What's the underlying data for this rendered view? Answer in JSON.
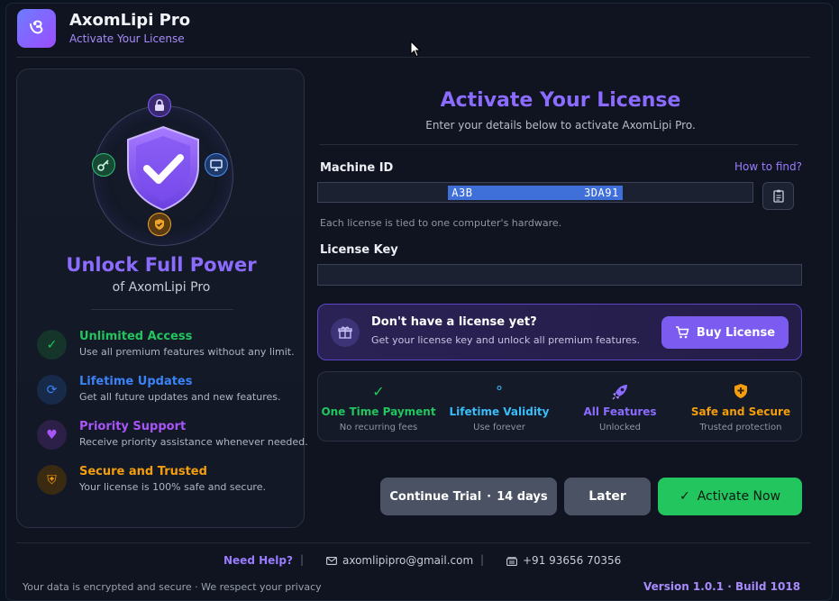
{
  "header": {
    "logo_glyph": "ও",
    "title": "AxomLipi Pro",
    "subtitle": "Activate Your License"
  },
  "left": {
    "heading": "Unlock Full Power",
    "subheading": "of AxomLipi Pro",
    "features": [
      {
        "icon": "check-icon",
        "glyph": "✓",
        "title": "Unlimited Access",
        "desc": "Use all premium features without any limit.",
        "color": "#22c55e"
      },
      {
        "icon": "refresh-icon",
        "glyph": "⟳",
        "title": "Lifetime Updates",
        "desc": "Get all future updates and new features.",
        "color": "#3b82f6"
      },
      {
        "icon": "heart-icon",
        "glyph": "♥",
        "title": "Priority Support",
        "desc": "Receive priority assistance whenever needed.",
        "color": "#a855f7"
      },
      {
        "icon": "shield-icon",
        "glyph": "⛨",
        "title": "Secure and Trusted",
        "desc": "Your license is 100% safe and secure.",
        "color": "#f59e0b"
      }
    ]
  },
  "main": {
    "title": "Activate Your License",
    "subtitle": "Enter your details below to activate AxomLipi Pro.",
    "machine_label": "Machine ID",
    "how_to_find": "How to find?",
    "machine_id": "A3B                3DA91",
    "machine_hint": "Each license is tied to one computer's hardware.",
    "license_label": "License Key",
    "license_value": "",
    "promo": {
      "title": "Don't have a license yet?",
      "desc": "Get your license key and unlock all premium features.",
      "buy_label": "Buy License"
    },
    "benefits": [
      {
        "icon": "check-icon",
        "glyph": "✓",
        "title": "One Time Payment",
        "sub": "No recurring fees",
        "color": "#22c55e"
      },
      {
        "icon": "infinity-icon",
        "glyph": "°",
        "title": "Lifetime Validity",
        "sub": "Use forever",
        "color": "#38bdf8"
      },
      {
        "icon": "rocket-icon",
        "glyph": "🚀",
        "title": "All Features",
        "sub": "Unlocked",
        "color": "#8b6cff"
      },
      {
        "icon": "shield-icon",
        "glyph": "⛨",
        "title": "Safe and Secure",
        "sub": "Trusted protection",
        "color": "#f59e0b"
      }
    ],
    "trial_label": "Continue Trial",
    "trial_sep": "·",
    "trial_days": "14 days",
    "later_label": "Later",
    "activate_label": "Activate Now",
    "activate_glyph": "✓"
  },
  "footer": {
    "help": "Need Help?",
    "sep": "|",
    "email": "axomlipipro@gmail.com",
    "phone": "+91 93656 70356",
    "privacy": "Your data is encrypted and secure  ·  We respect your privacy",
    "version": "Version 1.0.1   ·   Build 1018"
  },
  "colors": {
    "accent": "#8b6cff",
    "success": "#22c55e",
    "warning": "#f59e0b",
    "info": "#3b82f6"
  }
}
